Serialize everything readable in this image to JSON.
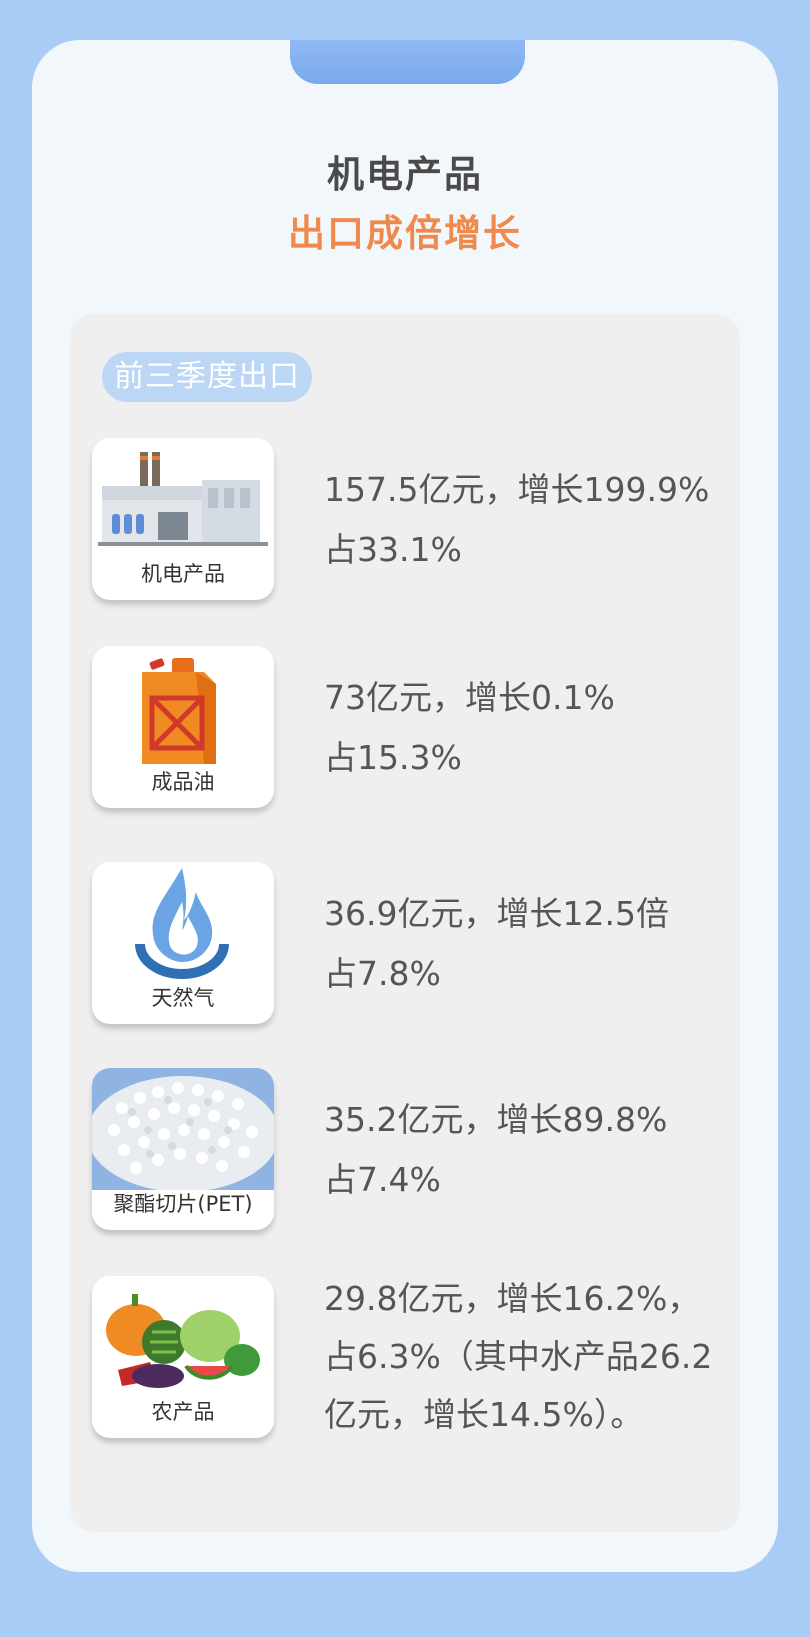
{
  "header": {
    "title_line1": "机电产品",
    "title_line2": "出口成倍增长"
  },
  "section": {
    "label": "前三季度出口"
  },
  "items": [
    {
      "icon": "factory-icon",
      "label": "机电产品",
      "text": "157.5亿元，增长199.9%\n占33.1%"
    },
    {
      "icon": "fuel-can-icon",
      "label": "成品油",
      "text": "73亿元，增长0.1%\n占15.3%"
    },
    {
      "icon": "gas-flame-icon",
      "label": "天然气",
      "text": "36.9亿元，增长12.5倍\n占7.8%"
    },
    {
      "icon": "pet-pellets-icon",
      "label": "聚酯切片(PET)",
      "text": "35.2亿元，增长89.8%\n占7.4%"
    },
    {
      "icon": "vegetables-icon",
      "label": "农产品",
      "text": "29.8亿元，增长16.2%，\n占6.3%（其中水产品26.2\n亿元，增长14.5%）。"
    }
  ],
  "colors": {
    "background": "#a9ccf6",
    "card": "#f2f7fc",
    "accent_orange": "#f0894c",
    "pill": "#bcd6f6"
  }
}
